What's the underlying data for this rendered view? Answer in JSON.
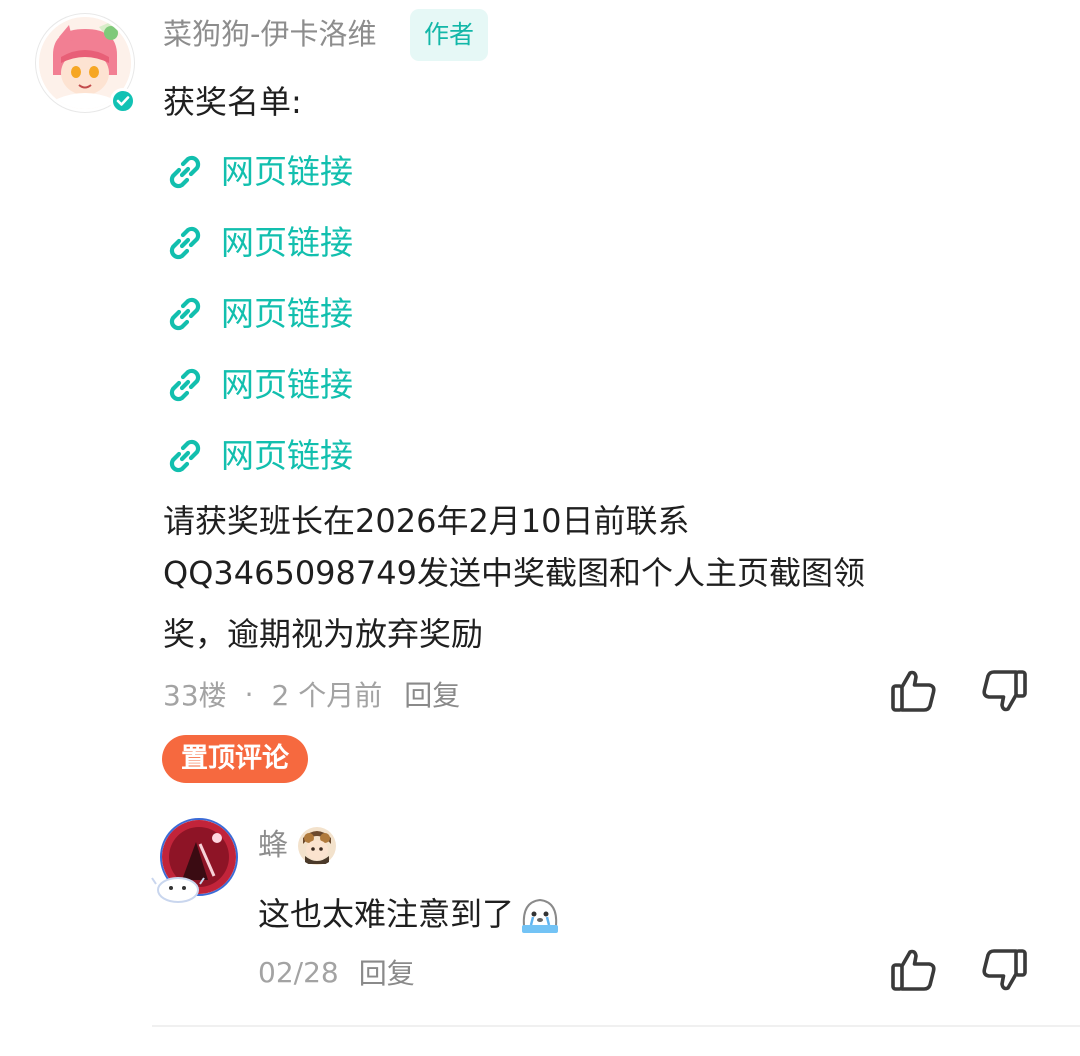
{
  "comment": {
    "username": "菜狗狗-伊卡洛维",
    "author_badge": "作者",
    "heading": "获奖名单:",
    "links": [
      {
        "label": "网页链接"
      },
      {
        "label": "网页链接"
      },
      {
        "label": "网页链接"
      },
      {
        "label": "网页链接"
      },
      {
        "label": "网页链接"
      }
    ],
    "body_lines": [
      "请获奖班长在2026年2月10日前联系",
      "QQ3465098749发送中奖截图和个人主页截图领",
      "奖，逾期视为放弃奖励"
    ],
    "floor": "33楼",
    "separator": "·",
    "time": "2 个月前",
    "reply_label": "回复",
    "pinned_label": "置顶评论",
    "icons": {
      "avatar": "anime-avatar",
      "verified": "verified-check-icon",
      "link": "link-icon",
      "like": "thumbs-up-icon",
      "dislike": "thumbs-down-icon"
    }
  },
  "reply": {
    "username": "蜂",
    "text": "这也太难注意到了",
    "emoji": "crying-seal-emoji",
    "date": "02/28",
    "reply_label": "回复"
  },
  "colors": {
    "accent": "#12bfae",
    "pinned": "#f6693f",
    "muted_text": "#a3a3a3",
    "body_text": "#1f1f1f"
  }
}
